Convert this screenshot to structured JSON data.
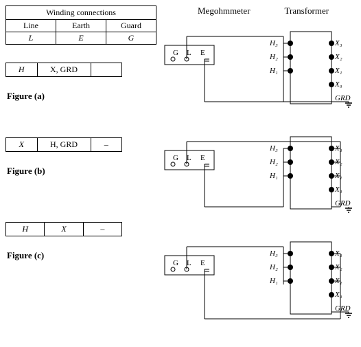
{
  "winding": {
    "title": "Winding connections",
    "headers": [
      "Line",
      "Earth",
      "Guard"
    ],
    "values": [
      "L",
      "E",
      "G"
    ]
  },
  "figures": [
    {
      "label": "Figure (a)",
      "conn": [
        {
          "cells": [
            "H",
            "X, GRD",
            ""
          ],
          "widths": [
            1,
            2,
            1
          ]
        }
      ]
    },
    {
      "label": "Figure (b)",
      "conn": [
        {
          "cells": [
            "X",
            "H, GRD",
            "–"
          ],
          "widths": [
            1,
            2,
            1
          ]
        }
      ]
    },
    {
      "label": "Figure (c)",
      "conn": [
        {
          "cells": [
            "H",
            "X",
            "–"
          ],
          "widths": [
            1,
            1,
            1
          ]
        }
      ]
    }
  ],
  "diagram_labels": {
    "megohmmeter": "Megohmmeter",
    "transformer": "Transformer",
    "H_labels": [
      "H₃",
      "H₂",
      "H₁"
    ],
    "X_labels": [
      "X₃",
      "X₂",
      "X₁",
      "X₀"
    ],
    "GRD": "GRD",
    "GLELabels": [
      "G",
      "L",
      "E"
    ]
  }
}
